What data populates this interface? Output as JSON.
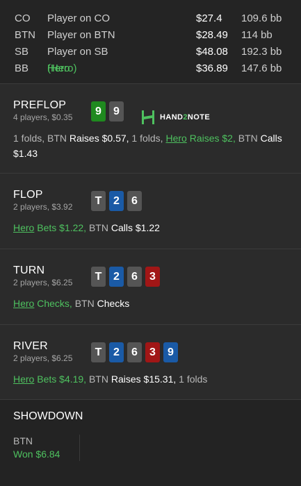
{
  "players": [
    {
      "pos": "CO",
      "name": "Player on CO",
      "stack": "$27.4",
      "bb": "109.6 bb",
      "hero": false
    },
    {
      "pos": "BTN",
      "name": "Player on BTN",
      "stack": "$28.49",
      "bb": "114 bb",
      "hero": false
    },
    {
      "pos": "SB",
      "name": "Player on SB",
      "stack": "$48.08",
      "bb": "192.3 bb",
      "hero": false
    },
    {
      "pos": "BB",
      "name": "Hero",
      "name_suffix": " (Hero)",
      "stack": "$36.89",
      "bb": "147.6 bb",
      "hero": true
    }
  ],
  "preflop": {
    "title": "PREFLOP",
    "sub": "4 players, $0.35",
    "cards": [
      "9",
      "9"
    ],
    "logo": {
      "pre": "HAND",
      "mid": "2",
      "post": "NOTE",
      "icon": "hand2note-logo-icon"
    },
    "actions": {
      "a1": "1 folds, BTN ",
      "a2": "Raises $0.57,",
      "a3": " 1 folds, ",
      "hero": "Hero",
      "a4": " Raises $2,",
      "a5": " BTN ",
      "a6": "Calls $1.43"
    }
  },
  "flop": {
    "title": "FLOP",
    "sub": "2 players, $3.92",
    "cards": [
      "T",
      "2",
      "6"
    ],
    "actions": {
      "hero": "Hero",
      "a1": " Bets $1.22,",
      "a2": " BTN ",
      "a3": "Calls $1.22"
    }
  },
  "turn": {
    "title": "TURN",
    "sub": "2 players, $6.25",
    "cards": [
      "T",
      "2",
      "6",
      "3"
    ],
    "actions": {
      "hero": "Hero",
      "a1": " Checks,",
      "a2": " BTN ",
      "a3": "Checks"
    }
  },
  "river": {
    "title": "RIVER",
    "sub": "2 players, $6.25",
    "cards": [
      "T",
      "2",
      "6",
      "3",
      "9"
    ],
    "actions": {
      "hero": "Hero",
      "a1": " Bets $4.19,",
      "a2": " BTN ",
      "a3": "Raises $15.31,",
      "a4": " 1 folds"
    }
  },
  "showdown": {
    "title": "SHOWDOWN",
    "pos": "BTN",
    "won": "Won $6.84"
  },
  "colors": {
    "hero": "#4ec15f",
    "card_green": "#1f8a1f",
    "card_gray": "#555555",
    "card_blue": "#1a5aa6",
    "card_red": "#a11616"
  }
}
